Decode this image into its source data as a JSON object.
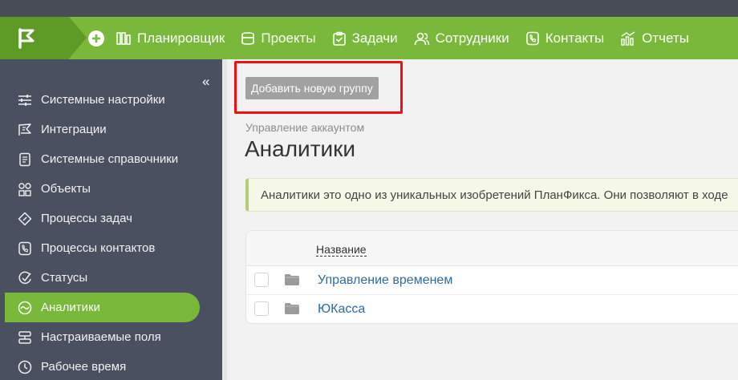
{
  "nav": {
    "items": [
      {
        "label": "Планировщик",
        "icon": "planner-icon"
      },
      {
        "label": "Проекты",
        "icon": "projects-icon"
      },
      {
        "label": "Задачи",
        "icon": "tasks-icon"
      },
      {
        "label": "Сотрудники",
        "icon": "employees-icon"
      },
      {
        "label": "Контакты",
        "icon": "contacts-icon"
      },
      {
        "label": "Отчеты",
        "icon": "reports-icon"
      }
    ]
  },
  "sidebar": {
    "collapse_glyph": "«",
    "items": [
      {
        "label": "Системные настройки",
        "icon": "sliders-icon"
      },
      {
        "label": "Интеграции",
        "icon": "integrations-icon"
      },
      {
        "label": "Системные справочники",
        "icon": "directory-icon"
      },
      {
        "label": "Объекты",
        "icon": "objects-icon"
      },
      {
        "label": "Процессы задач",
        "icon": "task-process-icon"
      },
      {
        "label": "Процессы контактов",
        "icon": "contact-process-icon"
      },
      {
        "label": "Статусы",
        "icon": "statuses-icon"
      },
      {
        "label": "Аналитики",
        "icon": "analytics-icon",
        "active": true
      },
      {
        "label": "Настраиваемые поля",
        "icon": "custom-fields-icon"
      },
      {
        "label": "Рабочее время",
        "icon": "clock-icon"
      }
    ]
  },
  "main": {
    "add_group_label": "Добавить новую группу",
    "breadcrumb": "Управление аккаунтом",
    "title": "Аналитики",
    "info_text": "Аналитики это одно из уникальных изобретений ПланФикса. Они позволяют в ходе",
    "table": {
      "column_name": "Название",
      "rows": [
        {
          "name": "Управление временем"
        },
        {
          "name": "ЮКасса"
        }
      ]
    }
  },
  "colors": {
    "accent": "#79b83a",
    "sidebar": "#4b5060",
    "highlight": "#ee1111",
    "link": "#2c6aa6"
  }
}
